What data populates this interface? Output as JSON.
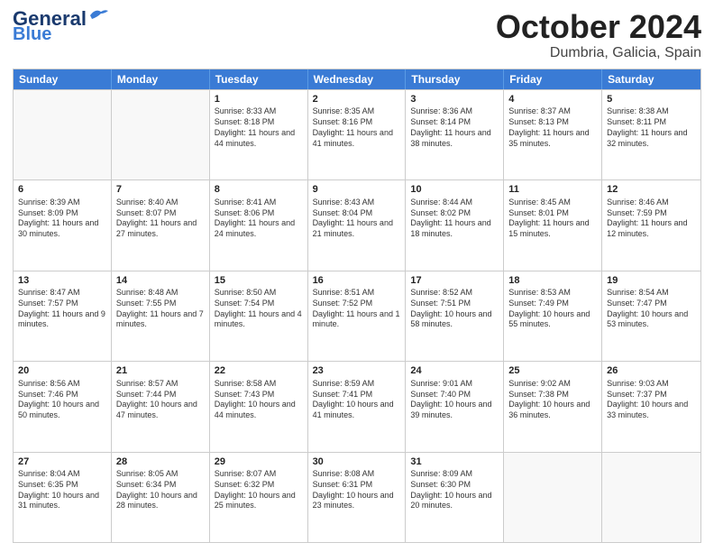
{
  "header": {
    "logo_line1": "General",
    "logo_line2": "Blue",
    "month": "October 2024",
    "location": "Dumbria, Galicia, Spain"
  },
  "weekdays": [
    "Sunday",
    "Monday",
    "Tuesday",
    "Wednesday",
    "Thursday",
    "Friday",
    "Saturday"
  ],
  "weeks": [
    [
      {
        "day": "",
        "info": ""
      },
      {
        "day": "",
        "info": ""
      },
      {
        "day": "1",
        "info": "Sunrise: 8:33 AM\nSunset: 8:18 PM\nDaylight: 11 hours and 44 minutes."
      },
      {
        "day": "2",
        "info": "Sunrise: 8:35 AM\nSunset: 8:16 PM\nDaylight: 11 hours and 41 minutes."
      },
      {
        "day": "3",
        "info": "Sunrise: 8:36 AM\nSunset: 8:14 PM\nDaylight: 11 hours and 38 minutes."
      },
      {
        "day": "4",
        "info": "Sunrise: 8:37 AM\nSunset: 8:13 PM\nDaylight: 11 hours and 35 minutes."
      },
      {
        "day": "5",
        "info": "Sunrise: 8:38 AM\nSunset: 8:11 PM\nDaylight: 11 hours and 32 minutes."
      }
    ],
    [
      {
        "day": "6",
        "info": "Sunrise: 8:39 AM\nSunset: 8:09 PM\nDaylight: 11 hours and 30 minutes."
      },
      {
        "day": "7",
        "info": "Sunrise: 8:40 AM\nSunset: 8:07 PM\nDaylight: 11 hours and 27 minutes."
      },
      {
        "day": "8",
        "info": "Sunrise: 8:41 AM\nSunset: 8:06 PM\nDaylight: 11 hours and 24 minutes."
      },
      {
        "day": "9",
        "info": "Sunrise: 8:43 AM\nSunset: 8:04 PM\nDaylight: 11 hours and 21 minutes."
      },
      {
        "day": "10",
        "info": "Sunrise: 8:44 AM\nSunset: 8:02 PM\nDaylight: 11 hours and 18 minutes."
      },
      {
        "day": "11",
        "info": "Sunrise: 8:45 AM\nSunset: 8:01 PM\nDaylight: 11 hours and 15 minutes."
      },
      {
        "day": "12",
        "info": "Sunrise: 8:46 AM\nSunset: 7:59 PM\nDaylight: 11 hours and 12 minutes."
      }
    ],
    [
      {
        "day": "13",
        "info": "Sunrise: 8:47 AM\nSunset: 7:57 PM\nDaylight: 11 hours and 9 minutes."
      },
      {
        "day": "14",
        "info": "Sunrise: 8:48 AM\nSunset: 7:55 PM\nDaylight: 11 hours and 7 minutes."
      },
      {
        "day": "15",
        "info": "Sunrise: 8:50 AM\nSunset: 7:54 PM\nDaylight: 11 hours and 4 minutes."
      },
      {
        "day": "16",
        "info": "Sunrise: 8:51 AM\nSunset: 7:52 PM\nDaylight: 11 hours and 1 minute."
      },
      {
        "day": "17",
        "info": "Sunrise: 8:52 AM\nSunset: 7:51 PM\nDaylight: 10 hours and 58 minutes."
      },
      {
        "day": "18",
        "info": "Sunrise: 8:53 AM\nSunset: 7:49 PM\nDaylight: 10 hours and 55 minutes."
      },
      {
        "day": "19",
        "info": "Sunrise: 8:54 AM\nSunset: 7:47 PM\nDaylight: 10 hours and 53 minutes."
      }
    ],
    [
      {
        "day": "20",
        "info": "Sunrise: 8:56 AM\nSunset: 7:46 PM\nDaylight: 10 hours and 50 minutes."
      },
      {
        "day": "21",
        "info": "Sunrise: 8:57 AM\nSunset: 7:44 PM\nDaylight: 10 hours and 47 minutes."
      },
      {
        "day": "22",
        "info": "Sunrise: 8:58 AM\nSunset: 7:43 PM\nDaylight: 10 hours and 44 minutes."
      },
      {
        "day": "23",
        "info": "Sunrise: 8:59 AM\nSunset: 7:41 PM\nDaylight: 10 hours and 41 minutes."
      },
      {
        "day": "24",
        "info": "Sunrise: 9:01 AM\nSunset: 7:40 PM\nDaylight: 10 hours and 39 minutes."
      },
      {
        "day": "25",
        "info": "Sunrise: 9:02 AM\nSunset: 7:38 PM\nDaylight: 10 hours and 36 minutes."
      },
      {
        "day": "26",
        "info": "Sunrise: 9:03 AM\nSunset: 7:37 PM\nDaylight: 10 hours and 33 minutes."
      }
    ],
    [
      {
        "day": "27",
        "info": "Sunrise: 8:04 AM\nSunset: 6:35 PM\nDaylight: 10 hours and 31 minutes."
      },
      {
        "day": "28",
        "info": "Sunrise: 8:05 AM\nSunset: 6:34 PM\nDaylight: 10 hours and 28 minutes."
      },
      {
        "day": "29",
        "info": "Sunrise: 8:07 AM\nSunset: 6:32 PM\nDaylight: 10 hours and 25 minutes."
      },
      {
        "day": "30",
        "info": "Sunrise: 8:08 AM\nSunset: 6:31 PM\nDaylight: 10 hours and 23 minutes."
      },
      {
        "day": "31",
        "info": "Sunrise: 8:09 AM\nSunset: 6:30 PM\nDaylight: 10 hours and 20 minutes."
      },
      {
        "day": "",
        "info": ""
      },
      {
        "day": "",
        "info": ""
      }
    ]
  ]
}
